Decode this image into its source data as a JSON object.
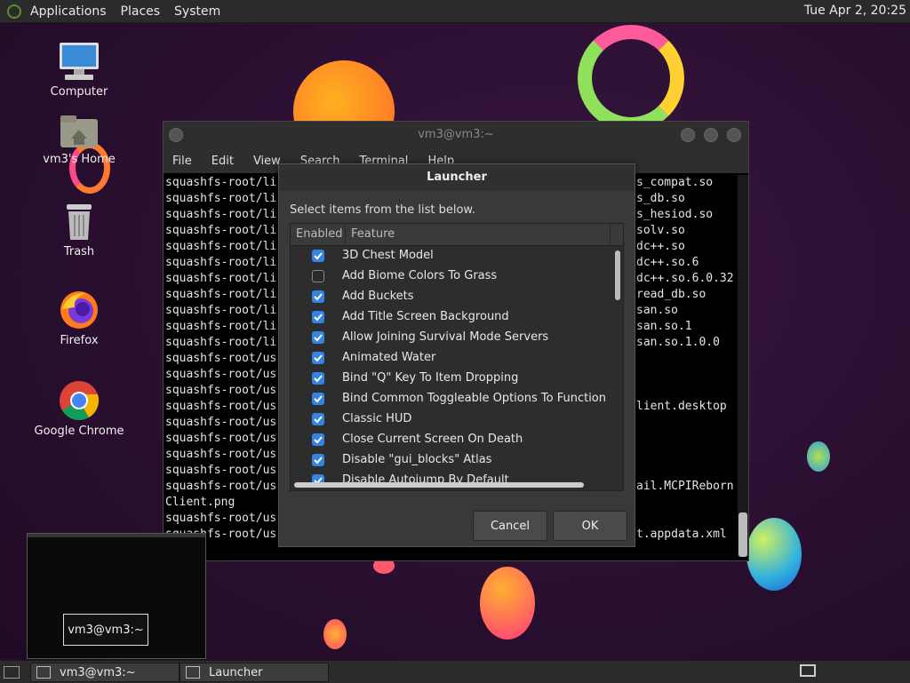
{
  "top_panel": {
    "menus": [
      "Applications",
      "Places",
      "System"
    ],
    "clock": "Tue Apr  2, 20:25"
  },
  "desktop_icons": [
    {
      "label": "Computer",
      "icon": "computer-icon"
    },
    {
      "label": "vm3's Home",
      "icon": "home-folder-icon"
    },
    {
      "label": "Trash",
      "icon": "trash-icon"
    },
    {
      "label": "Firefox",
      "icon": "firefox-icon"
    },
    {
      "label": "Google Chrome",
      "icon": "chrome-icon"
    }
  ],
  "terminal": {
    "title": "vm3@vm3:~",
    "menu": [
      "File",
      "Edit",
      "View",
      "Search",
      "Terminal",
      "Help"
    ],
    "left_lines": [
      "squashfs-root/li",
      "squashfs-root/li",
      "squashfs-root/li",
      "squashfs-root/li",
      "squashfs-root/li",
      "squashfs-root/li",
      "squashfs-root/li",
      "squashfs-root/li",
      "squashfs-root/li",
      "squashfs-root/li",
      "squashfs-root/li",
      "squashfs-root/us",
      "squashfs-root/us",
      "squashfs-root/us",
      "squashfs-root/us",
      "squashfs-root/us",
      "squashfs-root/us",
      "squashfs-root/us",
      "squashfs-root/us",
      "squashfs-root/us",
      "Client.png",
      "squashfs-root/us",
      "squashfs-root/us"
    ],
    "right_lines": [
      "s_compat.so",
      "s_db.so",
      "s_hesiod.so",
      "solv.so",
      "dc++.so",
      "dc++.so.6",
      "dc++.so.6.0.32",
      "read_db.so",
      "san.so",
      "san.so.1",
      "san.so.1.0.0",
      "",
      "",
      "",
      "lient.desktop",
      "",
      "",
      "",
      "",
      "ail.MCPIReborn",
      "",
      "",
      "t.appdata.xml"
    ]
  },
  "dialog": {
    "title": "Launcher",
    "prompt": "Select items from the list below.",
    "columns": [
      "Enabled",
      "Feature"
    ],
    "items": [
      {
        "enabled": true,
        "feature": "3D Chest Model"
      },
      {
        "enabled": false,
        "feature": "Add Biome Colors To Grass"
      },
      {
        "enabled": true,
        "feature": "Add Buckets"
      },
      {
        "enabled": true,
        "feature": "Add Title Screen Background"
      },
      {
        "enabled": true,
        "feature": "Allow Joining Survival Mode Servers"
      },
      {
        "enabled": true,
        "feature": "Animated Water"
      },
      {
        "enabled": true,
        "feature": "Bind \"Q\" Key To Item Dropping"
      },
      {
        "enabled": true,
        "feature": "Bind Common Toggleable Options To Function K"
      },
      {
        "enabled": true,
        "feature": "Classic HUD"
      },
      {
        "enabled": true,
        "feature": "Close Current Screen On Death"
      },
      {
        "enabled": true,
        "feature": "Disable \"gui_blocks\" Atlas"
      },
      {
        "enabled": true,
        "feature": "Disable Autojump By Default"
      }
    ],
    "cancel_label": "Cancel",
    "ok_label": "OK"
  },
  "taskbar": {
    "tasks": [
      {
        "label": "vm3@vm3:~"
      },
      {
        "label": "Launcher"
      }
    ]
  },
  "preview": {
    "label": "vm3@vm3:~"
  }
}
